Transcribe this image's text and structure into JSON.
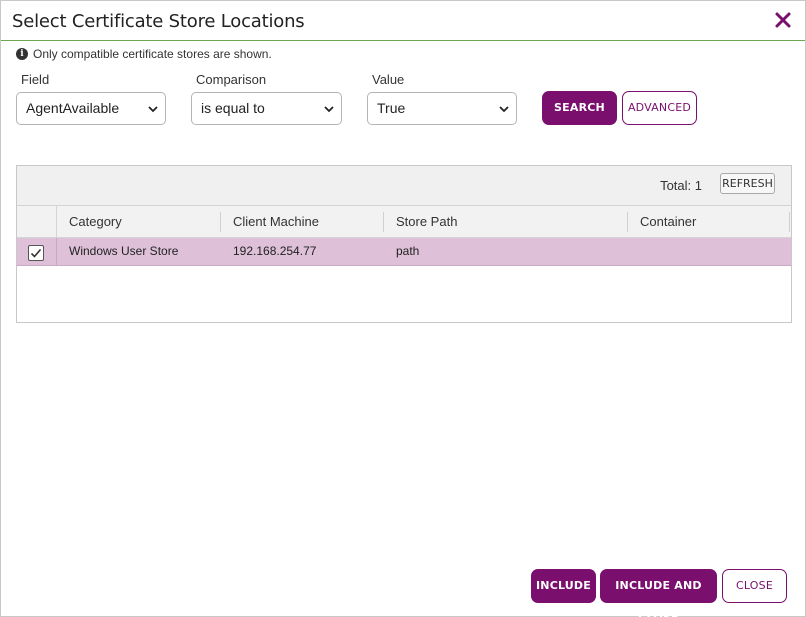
{
  "dialog": {
    "title": "Select Certificate Store Locations",
    "info_text": "Only compatible certificate stores are shown."
  },
  "filter": {
    "field_label": "Field",
    "field_value": "AgentAvailable",
    "comparison_label": "Comparison",
    "comparison_value": "is equal to",
    "value_label": "Value",
    "value_value": "True",
    "search_label": "SEARCH",
    "advanced_label": "ADVANCED"
  },
  "grid": {
    "total_text": "Total: 1",
    "refresh_label": "REFRESH",
    "columns": [
      "Category",
      "Client Machine",
      "Store Path",
      "Container"
    ],
    "rows": [
      {
        "selected": true,
        "category": "Windows User Store",
        "client_machine": "192.168.254.77",
        "store_path": "path",
        "container": ""
      }
    ]
  },
  "footer": {
    "include_label": "INCLUDE",
    "include_close_label": "INCLUDE AND CLOSE",
    "close_label": "CLOSE"
  },
  "colors": {
    "accent": "#7a0f6e",
    "selected_row": "#dec0d9",
    "title_underline": "#6aa84f"
  },
  "icons": {
    "close": "close-icon",
    "info": "info-icon",
    "chevron": "chevron-down-icon",
    "checkbox": "checkbox-checked-icon"
  }
}
